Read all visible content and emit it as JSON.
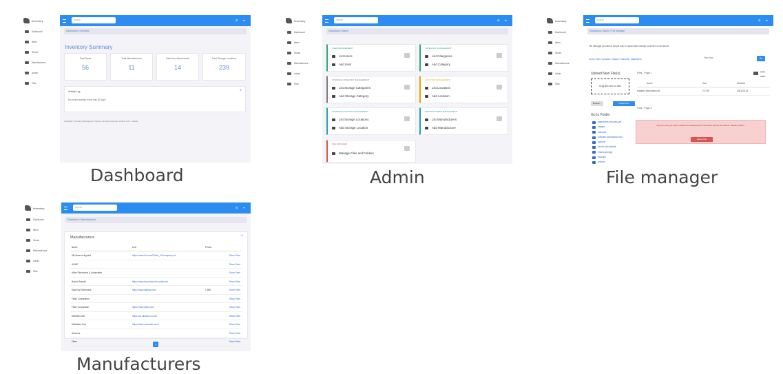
{
  "sidebar_nav": {
    "dashboard": "Dashboard",
    "item2": "Items",
    "item3": "Stores",
    "item4": "Manufacturers",
    "item5": "Admin",
    "item6": "Files"
  },
  "captions": {
    "dashboard": "Dashboard",
    "admin": "Admin",
    "file_manager": "File manager",
    "manufacturers": "Manufacturers"
  },
  "dashboard": {
    "breadcrumb": "Dashboard / Overview",
    "heading": "Inventory Summary",
    "stats": [
      {
        "label": "Total Items",
        "value": "56"
      },
      {
        "label": "Total Manufacturers",
        "value": "11"
      },
      {
        "label": "Total Item Attachments",
        "value": "14"
      },
      {
        "label": "Total Storage Locations",
        "value": "239"
      }
    ],
    "log_title": "Activity Log",
    "log_text": "No recent activity in the last 30 days.",
    "footer": "Copyright © Inventory Management System. All rights reserved. Version 1.3.0 - GitHub"
  },
  "admin": {
    "breadcrumb": "Dashboard / Admin",
    "cards": [
      {
        "title": "USER MANAGEMENT",
        "color": "#2aa876",
        "rows": [
          "List Users",
          "Add User"
        ]
      },
      {
        "title": "CATEGORY MANAGEMENT",
        "color": "#2aa876",
        "rows": [
          "List Categories",
          "Add Category"
        ]
      },
      {
        "title": "STORAGE CATEGORY MANAGEMENT",
        "color": "#7a7a7a",
        "rows": [
          "List Storage Categories",
          "Add Storage Category"
        ]
      },
      {
        "title": "LOCATION MANAGEMENT",
        "color": "#e0a800",
        "rows": [
          "List Locations",
          "Add Location"
        ]
      },
      {
        "title": "STORAGE LOCATION MANAGEMENT",
        "color": "#1aa3b8",
        "rows": [
          "List Storage Locations",
          "Add Storage Location"
        ]
      },
      {
        "title": "MANUFACTURER MANAGEMENT",
        "color": "#1aa3b8",
        "rows": [
          "List Manufacturers",
          "Add Manufacturer"
        ]
      },
      {
        "title": "FILE MANAGER",
        "color": "#d9534f",
        "rows": [
          "Manage Files and Folders"
        ]
      }
    ]
  },
  "file_manager": {
    "breadcrumb": "Dashboard / Admin / File Manager",
    "notice": "File Manager provides a simple way to upload and manage your files on the server.",
    "path": "Home / files / uploads / images / manuals / datasheets",
    "path_input": "Filter files",
    "go_button": "Go",
    "upload_title": "Upload New File(s)",
    "drop_text": "Drag files here or click",
    "browse_button": "Browse...",
    "upload_button": "Upload files",
    "folder_title": "Go to Folder",
    "folders": [
      "datasheets-manuals-pdf",
      "images",
      "manuals",
      "software-downloads-misc",
      "uploads",
      "vendor-documents",
      "photos-storage",
      "backups",
      "archive"
    ],
    "table_headers": [
      "Name",
      "Size",
      "Modified"
    ],
    "files_label": "Files - Page 1",
    "files": [
      {
        "name": "readme_instructions.txt",
        "size": "2.3 KB",
        "modified": "2023-05-21"
      }
    ],
    "files_label2": "Files - Page 2",
    "alert_text": "Are you sure you want to delete the selected file? This action cannot be undone. Please confirm.",
    "alert_button": "Delete File"
  },
  "manufacturers": {
    "breadcrumb": "Dashboard / Manufacturers",
    "title": "Manufacturers",
    "headers": [
      "Name",
      "Link",
      "Phone"
    ],
    "rows": [
      {
        "name": "3M Science Applied",
        "link": "https://www.3m.com/3M/en_US/company-us/",
        "phone": "",
        "action": "Show Parts"
      },
      {
        "name": "ACME",
        "link": "",
        "phone": "",
        "action": "Show Parts"
      },
      {
        "name": "Allied Electronics & Automation",
        "link": "",
        "phone": "",
        "action": "Show Parts"
      },
      {
        "name": "Bosch Rexroth",
        "link": "https://www.boschrexroth.com/en/us/",
        "phone": "",
        "action": "Show Parts"
      },
      {
        "name": "Digi-Key Electronics",
        "link": "https://www.digikey.com/",
        "phone": "1-800",
        "action": "Show Parts"
      },
      {
        "name": "Festo Corporation",
        "link": "",
        "phone": "",
        "action": "Show Parts"
      },
      {
        "name": "Fluke Corporation",
        "link": "https://www.fluke.com/",
        "phone": "",
        "action": "Show Parts"
      },
      {
        "name": "MISUMI USA",
        "link": "https://us.misumi-ec.com/",
        "phone": "",
        "action": "Show Parts"
      },
      {
        "name": "McMaster-Carr",
        "link": "https://www.mcmaster.com/",
        "phone": "",
        "action": "Show Parts"
      },
      {
        "name": "Siemens",
        "link": "",
        "phone": "",
        "action": "Show Parts"
      },
      {
        "name": "Other",
        "link": "",
        "phone": "",
        "action": "Show Parts"
      }
    ],
    "page_number": "1"
  }
}
